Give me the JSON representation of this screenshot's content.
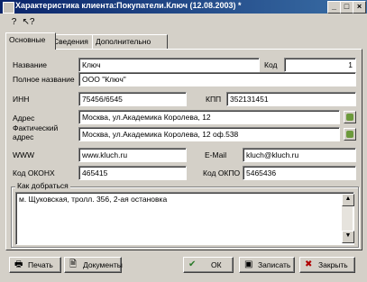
{
  "window": {
    "title": "Характеристика клиента:Покупатели.Ключ (12.08.2003) *"
  },
  "titlebar_buttons": [
    "_",
    "□",
    "×"
  ],
  "toolbar": {
    "help_glyph": "?",
    "whatsthis_glyph": "↖?"
  },
  "tabs": [
    "Основные",
    "Сведения",
    "Дополнительно"
  ],
  "form": {
    "name_label": "Название",
    "name_value": "Ключ",
    "code_label": "Код",
    "code_value": "1",
    "full_name_label": "Полное название",
    "full_name_value": "ООО \"Ключ\"",
    "inn_label": "ИНН",
    "inn_value": "75456/6545",
    "kpp_label": "КПП",
    "kpp_value": "352131451",
    "address_label": "Адрес",
    "address_value": "Москва, ул.Академика Королева, 12",
    "actual_address_label": "Фактический адрес",
    "actual_address_value": "Москва, ул.Академика Королева, 12 оф.538",
    "www_label": "WWW",
    "www_value": "www.kluch.ru",
    "email_label": "E-Mail",
    "email_value": "kluch@kluch.ru",
    "okonh_label": "Код ОКОНХ",
    "okonh_value": "465415",
    "okpo_label": "Код ОКПО",
    "okpo_value": "5465436"
  },
  "directions": {
    "title": "Как добраться",
    "text": "м. Щуковская, тролл. 356, 2-ая остановка"
  },
  "buttons": {
    "print": "Печать",
    "documents": "Документы",
    "ok": "ОК",
    "save": "Записать",
    "close": "Закрыть"
  },
  "colors": {
    "titlebar_start": "#0a246a",
    "titlebar_end": "#3a6ea5",
    "face": "#d4d0c8"
  }
}
